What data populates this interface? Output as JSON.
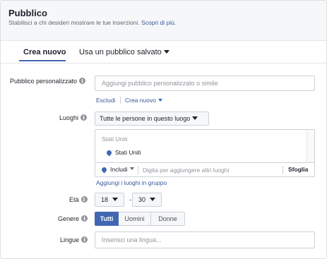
{
  "header": {
    "title": "Pubblico",
    "subtitle": "Stabilisci a chi desideri mostrare le tue inserzioni.",
    "learn_more": "Scopri di più."
  },
  "tabs": [
    {
      "label": "Crea nuovo",
      "active": true
    },
    {
      "label": "Usa un pubblico salvato",
      "active": false
    }
  ],
  "custom_audience": {
    "label": "Pubblico personalizzato",
    "placeholder": "Aggiungi pubblico personalizzato o simile",
    "exclude_label": "Escludi",
    "create_new_label": "Crea nuovo"
  },
  "locations": {
    "label": "Luoghi",
    "scope_selected": "Tutte le persone in questo luogo",
    "country_header": "Stati Uniti",
    "selected_items": [
      "Stati Uniti"
    ],
    "include_label": "Includi",
    "placeholder": "Digita per aggiungere altri luoghi",
    "browse_label": "Sfoglia",
    "add_group_label": "Aggiungi i luoghi in gruppo"
  },
  "age": {
    "label": "Età",
    "min": "18",
    "max": "30",
    "separator": "-"
  },
  "gender": {
    "label": "Genere",
    "options": [
      "Tutti",
      "Uomini",
      "Donne"
    ],
    "selected": "Tutti"
  },
  "languages": {
    "label": "Lingue",
    "placeholder": "Inserisci una lingua..."
  },
  "colors": {
    "accent": "#4267b2",
    "link": "#385898",
    "header_bg": "#f6f7f9",
    "border": "#ccd0d5"
  }
}
